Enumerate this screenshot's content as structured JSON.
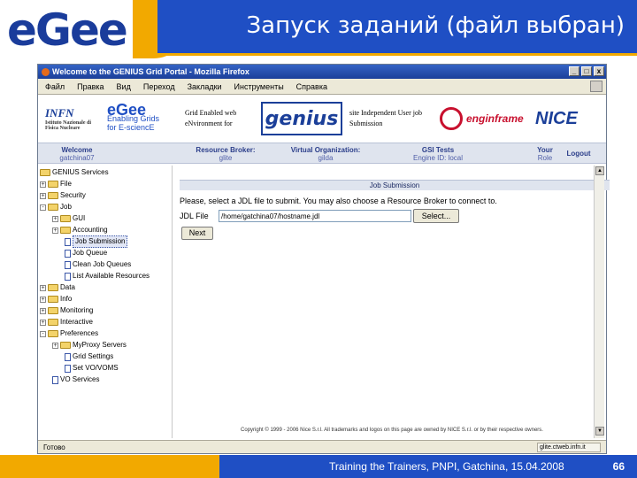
{
  "slide": {
    "logo": "eGee",
    "title": "Запуск заданий (файл выбран)",
    "footer": "Training the Trainers, PNPI, Gatchina, 15.04.2008",
    "page_number": "66"
  },
  "browser": {
    "window_title": "Welcome to the GENIUS Grid Portal - Mozilla Firefox",
    "window_buttons": [
      "_",
      "□",
      "x"
    ],
    "menu": [
      "Файл",
      "Правка",
      "Вид",
      "Переход",
      "Закладки",
      "Инструменты",
      "Справка"
    ],
    "status": "Готово",
    "status_url": "glite.ctweb.infn.it"
  },
  "logos": {
    "infn": "INFN",
    "infn_sub": "Istituto Nazionale di Fisica Nucleare",
    "egee_name": "eGee",
    "egee_line1": "Enabling Grids",
    "egee_line2": "for E-sciencE",
    "genius_left_1": "Grid Enabled web",
    "genius_left_2": "eNvironment for",
    "genius": "genius",
    "genius_right_1": "site Independent User job",
    "genius_right_2": "Submission",
    "enginframe": "enginframe",
    "nice": "NICE"
  },
  "nav": [
    {
      "label": "Welcome",
      "sub": "gatchina07"
    },
    {
      "label": "Resource Broker:",
      "sub": "glite"
    },
    {
      "label": "Virtual Organization:",
      "sub": "gilda"
    },
    {
      "label": "GSI Tests",
      "sub": "Engine ID: local"
    },
    {
      "label": "Your",
      "sub": "Role"
    },
    {
      "label": "Logout",
      "sub": ""
    }
  ],
  "tree": {
    "root": "GENIUS Services",
    "items": [
      "File",
      "Security",
      "Job",
      "GUI",
      "Accounting",
      "Job Submission",
      "Job Queue",
      "Clean Job Queues",
      "List Available Resources",
      "Data",
      "Info",
      "Monitoring",
      "Interactive",
      "Preferences",
      "MyProxy Servers",
      "Grid Settings",
      "Set VO/VOMS",
      "VO Services"
    ]
  },
  "content": {
    "section_title": "Job Submission",
    "instructions": "Please, select a JDL file to submit. You may also choose a Resource Broker to connect to.",
    "jdl_label": "JDL File",
    "jdl_value": "/home/gatchina07/hostname.jdl",
    "select_label": "Select...",
    "next_label": "Next",
    "copyright": "Copyright © 1999 - 2006 Nice S.r.l. All trademarks and logos on this page are owned by NICE S.r.l. or by their respective owners."
  }
}
